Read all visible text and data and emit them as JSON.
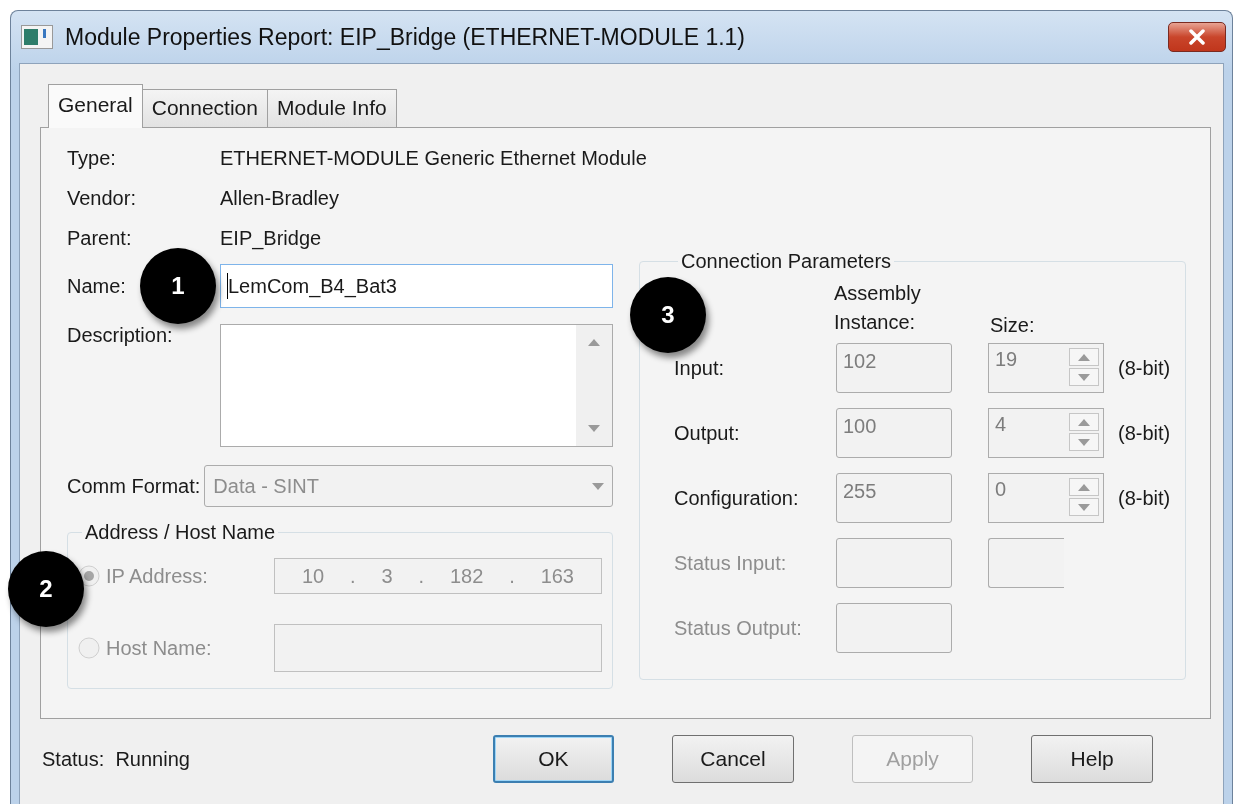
{
  "window": {
    "title": "Module Properties Report: EIP_Bridge (ETHERNET-MODULE 1.1)"
  },
  "tabs": [
    {
      "label": "General",
      "selected": true
    },
    {
      "label": "Connection",
      "selected": false
    },
    {
      "label": "Module Info",
      "selected": false
    }
  ],
  "general": {
    "info": [
      {
        "label": "Type:",
        "value": "ETHERNET-MODULE Generic Ethernet Module"
      },
      {
        "label": "Vendor:",
        "value": "Allen-Bradley"
      },
      {
        "label": "Parent:",
        "value": "EIP_Bridge"
      }
    ],
    "name": {
      "label": "Name:",
      "value": "LemCom_B4_Bat3",
      "callout": "1"
    },
    "description": {
      "label": "Description:"
    },
    "comm_format": {
      "label": "Comm Format:",
      "value": "Data - SINT",
      "disabled": true
    },
    "address_group": {
      "title": "Address / Host Name",
      "callout": "2",
      "options": [
        {
          "kind": "ip",
          "label": "IP Address:",
          "selected": true,
          "disabled": true,
          "octets": [
            "10",
            "3",
            "182",
            "163"
          ],
          "separator": "."
        },
        {
          "kind": "text",
          "label": "Host Name:",
          "selected": false,
          "disabled": true
        }
      ]
    }
  },
  "connection_parameters": {
    "title": "Connection Parameters",
    "callout": "3",
    "column_headers": [
      "Assembly Instance:",
      "Size:"
    ],
    "rows": [
      {
        "kind": "full",
        "label": "Input:",
        "disabled": false,
        "instance": "102",
        "size": "19",
        "unit": "(8-bit)"
      },
      {
        "kind": "full",
        "label": "Output:",
        "disabled": false,
        "instance": "100",
        "size": "4",
        "unit": "(8-bit)"
      },
      {
        "kind": "full",
        "label": "Configuration:",
        "disabled": false,
        "instance": "255",
        "size": "0",
        "unit": "(8-bit)"
      },
      {
        "kind": "blank",
        "label": "Status Input:",
        "disabled": true
      },
      {
        "kind": "instance_only",
        "label": "Status Output:",
        "disabled": true
      }
    ]
  },
  "status": {
    "label": "Status:",
    "value": "Running"
  },
  "buttons": [
    {
      "label": "OK",
      "default": true,
      "disabled": false
    },
    {
      "label": "Cancel",
      "default": false,
      "disabled": false
    },
    {
      "label": "Apply",
      "default": false,
      "disabled": true
    },
    {
      "label": "Help",
      "default": false,
      "disabled": false
    }
  ]
}
